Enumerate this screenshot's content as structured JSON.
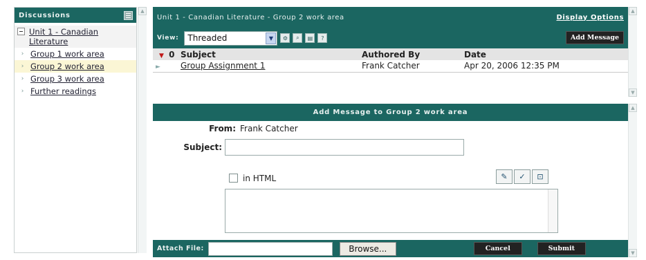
{
  "sidebar": {
    "title": "Discussions",
    "items": [
      {
        "label": "Unit 1 - Canadian Literature",
        "type": "unit"
      },
      {
        "label": "Group 1 work area",
        "type": "topic"
      },
      {
        "label": "Group 2 work area",
        "type": "topic",
        "active": true
      },
      {
        "label": "Group 3 work area",
        "type": "topic"
      },
      {
        "label": "Further readings",
        "type": "topic"
      }
    ]
  },
  "header": {
    "breadcrumb": "Unit 1 - Canadian Literature - Group 2 work area",
    "display_options": "Display Options"
  },
  "toolbar": {
    "view_label": "View:",
    "view_value": "Threaded",
    "add_message": "Add Message"
  },
  "messages": {
    "flag_count": "0",
    "columns": {
      "subject": "Subject",
      "author": "Authored By",
      "date": "Date"
    },
    "rows": [
      {
        "subject": "Group Assignment 1",
        "author": "Frank Catcher",
        "date": "Apr 20, 2006 12:35 PM"
      }
    ]
  },
  "compose": {
    "heading": "Add Message to Group 2 work area",
    "from_label": "From:",
    "from_value": "Frank Catcher",
    "subject_label": "Subject:",
    "html_label": "in HTML",
    "attach_label": "Attach File:",
    "browse": "Browse...",
    "cancel": "Cancel",
    "submit": "Submit"
  },
  "colors": {
    "accent": "#1b6661",
    "button": "#222222"
  }
}
